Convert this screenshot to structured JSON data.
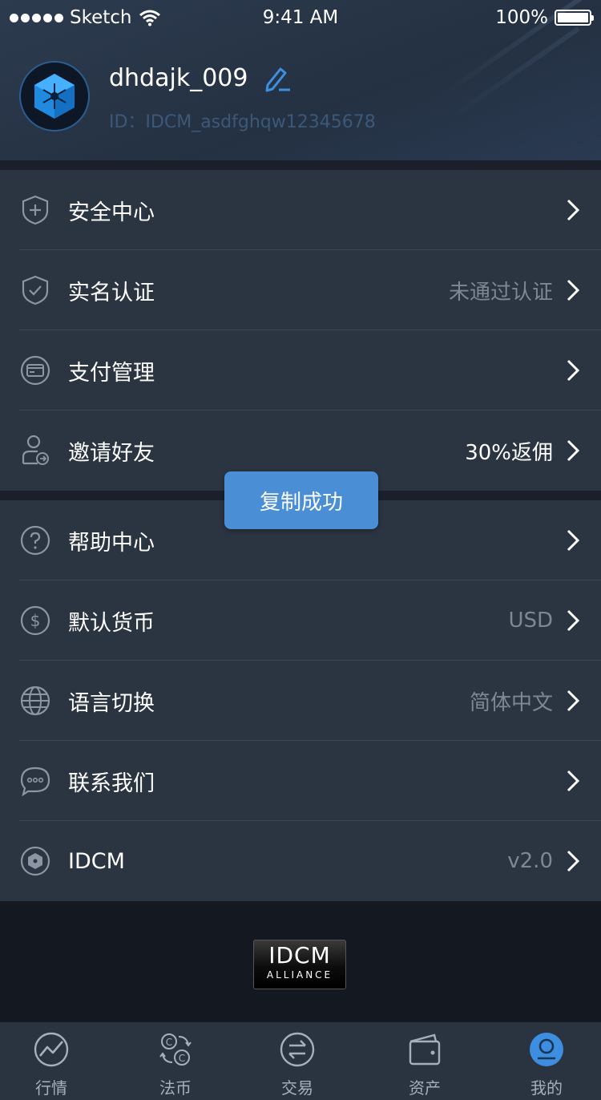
{
  "status_bar": {
    "carrier": "Sketch",
    "time": "9:41 AM",
    "battery": "100%"
  },
  "profile": {
    "username": "dhdajk_009",
    "user_id": "ID：IDCM_asdfghqw12345678"
  },
  "menu_group_1": [
    {
      "label": "安全中心",
      "value": "",
      "icon": "shield-plus-icon"
    },
    {
      "label": "实名认证",
      "value": "未通过认证",
      "icon": "shield-check-icon"
    },
    {
      "label": "支付管理",
      "value": "",
      "icon": "card-icon"
    },
    {
      "label": "邀请好友",
      "value": "30%返佣",
      "icon": "invite-user-icon"
    }
  ],
  "menu_group_2": [
    {
      "label": "帮助中心",
      "value": "",
      "icon": "help-icon"
    },
    {
      "label": "默认货币",
      "value": "USD",
      "icon": "dollar-icon"
    },
    {
      "label": "语言切换",
      "value": "简体中文",
      "icon": "globe-icon"
    },
    {
      "label": "联系我们",
      "value": "",
      "icon": "chat-icon"
    },
    {
      "label": "IDCM",
      "value": "v2.0",
      "icon": "idcm-icon"
    }
  ],
  "toast": {
    "text": "复制成功"
  },
  "brand": {
    "main": "IDCM",
    "sub": "ALLIANCE"
  },
  "tabbar": [
    {
      "label": "行情",
      "icon": "market-chart-icon"
    },
    {
      "label": "法币",
      "icon": "fiat-currency-icon"
    },
    {
      "label": "交易",
      "icon": "exchange-icon"
    },
    {
      "label": "资产",
      "icon": "wallet-icon"
    },
    {
      "label": "我的",
      "icon": "profile-icon",
      "active": true
    }
  ],
  "colors": {
    "accent": "#4a8fd6",
    "row_bg": "#2b3441",
    "page_bg": "#1a1f29"
  }
}
